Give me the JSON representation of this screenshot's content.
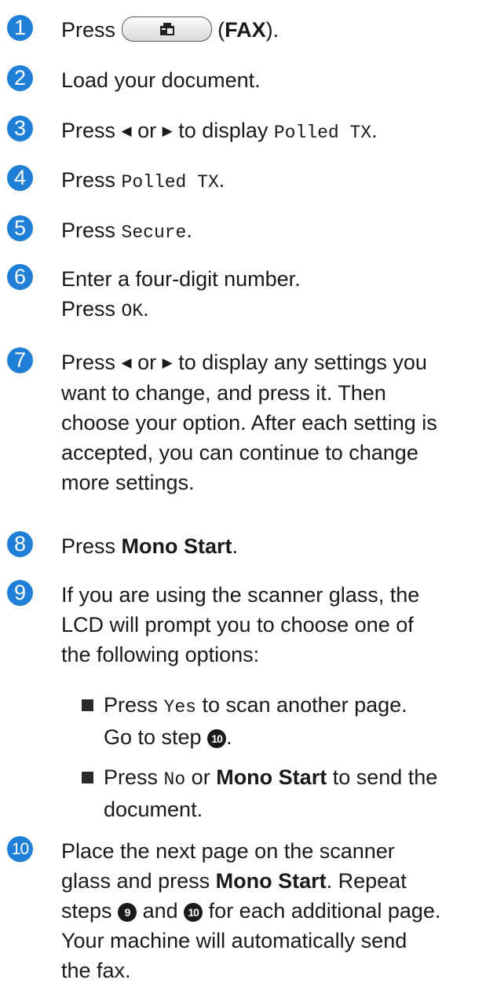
{
  "steps": [
    {
      "num": "1",
      "a": "Press",
      "b": "(",
      "c": "FAX",
      "d": ")."
    },
    {
      "num": "2",
      "a": "Load your document."
    },
    {
      "num": "3",
      "a": "Press",
      "b": "or",
      "c": "to display",
      "d": "Polled TX",
      "e": "."
    },
    {
      "num": "4",
      "a": "Press",
      "b": "Polled TX",
      "c": "."
    },
    {
      "num": "5",
      "a": "Press",
      "b": "Secure",
      "c": "."
    },
    {
      "num": "6",
      "a": "Enter a four-digit number.",
      "b": "Press",
      "c": "OK",
      "d": "."
    },
    {
      "num": "7",
      "a": "Press",
      "b": "or",
      "c": "to display any settings you",
      "d": "want to change, and press it. Then",
      "e": "choose your option. After each setting is",
      "f": "accepted, you can continue to change",
      "g": "more settings."
    },
    {
      "num": "8",
      "a": "Press",
      "b": "Mono Start",
      "c": "."
    },
    {
      "num": "9",
      "a": "If you are using the scanner glass, the",
      "b": "LCD will prompt you to choose one of",
      "c": "the following options:"
    },
    {
      "num": "10",
      "a": "Place the next page on the scanner",
      "b": "glass and press",
      "c": "Mono Start",
      "d": ". Repeat",
      "e": "steps",
      "f": "and",
      "g": "for each additional page.",
      "h": "Your machine will automatically send",
      "i": "the fax."
    }
  ],
  "bullets": [
    {
      "a": "Press",
      "b": "Yes",
      "c": "to scan another page.",
      "d": "Go to step",
      "e": "."
    },
    {
      "a": "Press",
      "b": "No",
      "c": "or",
      "d": "Mono Start",
      "e": "to send the",
      "f": "document."
    }
  ],
  "refs": {
    "nine": "9",
    "ten": "10"
  },
  "colors": {
    "step_badge": "#1f7fd6"
  },
  "icons": {
    "left_triangle": "◀",
    "right_triangle": "▶",
    "fax_button": "fax-icon"
  }
}
